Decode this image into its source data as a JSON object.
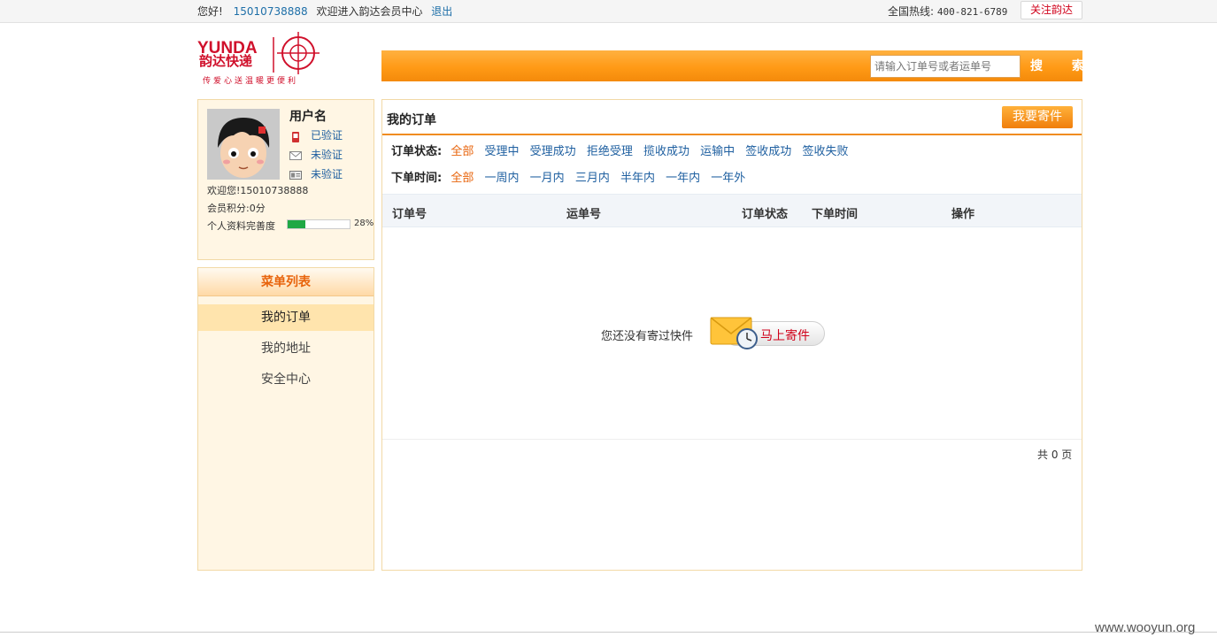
{
  "topbar": {
    "greeting": "您好!",
    "phone": "15010738888",
    "welcome": "欢迎进入韵达会员中心",
    "logout": "退出",
    "hotline_label": "全国热线:",
    "hotline_number": "400-821-6789",
    "follow": "关注韵达"
  },
  "logo": {
    "brand_en": "YUNDA",
    "brand_cn": "韵达快递",
    "slogan": "传爱心送温暖更便利"
  },
  "search": {
    "placeholder": "请输入订单号或者运单号",
    "button": "搜 索"
  },
  "profile": {
    "username": "用户名",
    "phone_status": "已验证",
    "email_status": "未验证",
    "id_status": "未验证",
    "welcome": "欢迎您!15010738888",
    "points": "会员积分:0分",
    "completeness_label": "个人资料完善度",
    "completeness_value": 0.28,
    "completeness_text": "28%"
  },
  "menu": {
    "title": "菜单列表",
    "items": [
      "我的订单",
      "我的地址",
      "安全中心"
    ],
    "active_index": 0
  },
  "orders": {
    "title": "我的订单",
    "ship_button": "我要寄件",
    "status_label": "订单状态:",
    "status_options": [
      "全部",
      "受理中",
      "受理成功",
      "拒绝受理",
      "揽收成功",
      "运输中",
      "签收成功",
      "签收失败"
    ],
    "time_label": "下单时间:",
    "time_options": [
      "全部",
      "一周内",
      "一月内",
      "三月内",
      "半年内",
      "一年内",
      "一年外"
    ],
    "columns": [
      "订单号",
      "运单号",
      "订单状态",
      "下单时间",
      "操作"
    ],
    "empty_text": "您还没有寄过快件",
    "ship_now": "马上寄件",
    "pager": "共 0 页"
  },
  "colors": {
    "accent": "#ff9a16",
    "link": "#1e5fa0",
    "brand_red": "#d0102b",
    "active_orange": "#e8640c"
  },
  "watermark": "www.wooyun.org"
}
